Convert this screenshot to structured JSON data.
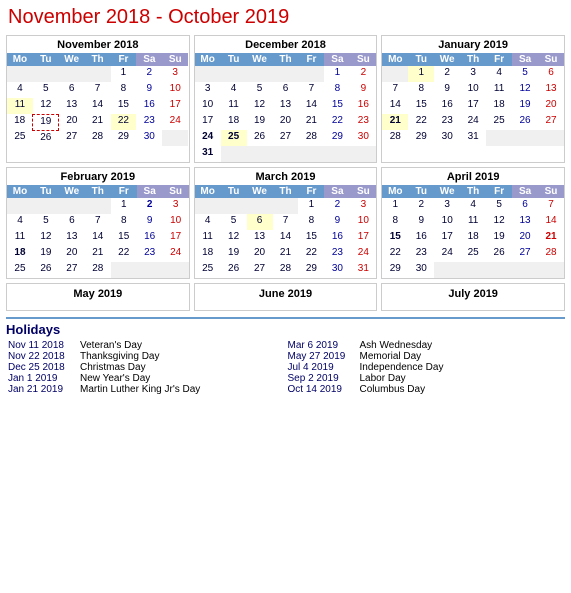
{
  "title": "November 2018 - October 2019",
  "calendars": [
    {
      "id": "nov2018",
      "title": "November 2018",
      "headers": [
        "Mo",
        "Tu",
        "We",
        "Th",
        "Fr",
        "Sa",
        "Su"
      ],
      "weeks": [
        [
          null,
          null,
          null,
          null,
          "1",
          "2",
          "3"
        ],
        [
          "4",
          "5",
          "6",
          "7",
          "8",
          "9",
          "10"
        ],
        [
          "11",
          "12",
          "13",
          "14",
          "15",
          "16",
          "17"
        ],
        [
          "18",
          "19",
          "20",
          "21",
          "22",
          "23",
          "24"
        ],
        [
          "25",
          "26",
          "27",
          "28",
          "29",
          "30",
          null
        ]
      ],
      "holidays": [
        11,
        22
      ],
      "today": 19,
      "bold": []
    },
    {
      "id": "dec2018",
      "title": "December 2018",
      "headers": [
        "Mo",
        "Tu",
        "We",
        "Th",
        "Fr",
        "Sa",
        "Su"
      ],
      "weeks": [
        [
          null,
          null,
          null,
          null,
          null,
          "1",
          "2"
        ],
        [
          "3",
          "4",
          "5",
          "6",
          "7",
          "8",
          "9"
        ],
        [
          "10",
          "11",
          "12",
          "13",
          "14",
          "15",
          "16"
        ],
        [
          "17",
          "18",
          "19",
          "20",
          "21",
          "22",
          "23"
        ],
        [
          "24",
          "25",
          "26",
          "27",
          "28",
          "29",
          "30"
        ],
        [
          "31",
          null,
          null,
          null,
          null,
          null,
          null
        ]
      ],
      "holidays": [
        25
      ],
      "today": null,
      "bold": [
        24,
        25,
        31
      ]
    },
    {
      "id": "jan2019",
      "title": "January 2019",
      "headers": [
        "Mo",
        "Tu",
        "We",
        "Th",
        "Fr",
        "Sa",
        "Su"
      ],
      "weeks": [
        [
          null,
          "1",
          "2",
          "3",
          "4",
          "5",
          "6"
        ],
        [
          "7",
          "8",
          "9",
          "10",
          "11",
          "12",
          "13"
        ],
        [
          "14",
          "15",
          "16",
          "17",
          "18",
          "19",
          "20"
        ],
        [
          "21",
          "22",
          "23",
          "24",
          "25",
          "26",
          "27"
        ],
        [
          "28",
          "29",
          "30",
          "31",
          null,
          null,
          null
        ]
      ],
      "holidays": [
        1,
        21
      ],
      "today": null,
      "bold": [
        21
      ]
    },
    {
      "id": "feb2019",
      "title": "February 2019",
      "headers": [
        "Mo",
        "Tu",
        "We",
        "Th",
        "Fr",
        "Sa",
        "Su"
      ],
      "weeks": [
        [
          null,
          null,
          null,
          null,
          "1",
          "2",
          "3"
        ],
        [
          "4",
          "5",
          "6",
          "7",
          "8",
          "9",
          "10"
        ],
        [
          "11",
          "12",
          "13",
          "14",
          "15",
          "16",
          "17"
        ],
        [
          "18",
          "19",
          "20",
          "21",
          "22",
          "23",
          "24"
        ],
        [
          "25",
          "26",
          "27",
          "28",
          null,
          null,
          null
        ]
      ],
      "holidays": [],
      "today": null,
      "bold": [
        2,
        18
      ]
    },
    {
      "id": "mar2019",
      "title": "March 2019",
      "headers": [
        "Mo",
        "Tu",
        "We",
        "Th",
        "Fr",
        "Sa",
        "Su"
      ],
      "weeks": [
        [
          null,
          null,
          null,
          null,
          "1",
          "2",
          "3"
        ],
        [
          "4",
          "5",
          "6",
          "7",
          "8",
          "9",
          "10"
        ],
        [
          "11",
          "12",
          "13",
          "14",
          "15",
          "16",
          "17"
        ],
        [
          "18",
          "19",
          "20",
          "21",
          "22",
          "23",
          "24"
        ],
        [
          "25",
          "26",
          "27",
          "28",
          "29",
          "30",
          "31"
        ]
      ],
      "holidays": [
        6
      ],
      "today": null,
      "bold": []
    },
    {
      "id": "apr2019",
      "title": "April 2019",
      "headers": [
        "Mo",
        "Tu",
        "We",
        "Th",
        "Fr",
        "Sa",
        "Su"
      ],
      "weeks": [
        [
          "1",
          "2",
          "3",
          "4",
          "5",
          "6",
          "7"
        ],
        [
          "8",
          "9",
          "10",
          "11",
          "12",
          "13",
          "14"
        ],
        [
          "15",
          "16",
          "17",
          "18",
          "19",
          "20",
          "21"
        ],
        [
          "22",
          "23",
          "24",
          "25",
          "26",
          "27",
          "28"
        ],
        [
          "29",
          "30",
          null,
          null,
          null,
          null,
          null
        ]
      ],
      "holidays": [],
      "today": null,
      "bold": [
        15,
        21
      ]
    }
  ],
  "partial_months": [
    {
      "id": "may2019",
      "title": "May 2019"
    },
    {
      "id": "jun2019",
      "title": "June 2019"
    },
    {
      "id": "jul2019",
      "title": "July 2019"
    }
  ],
  "holidays": {
    "title": "Holidays",
    "left": [
      {
        "date": "Nov 11 2018",
        "name": "Veteran's Day"
      },
      {
        "date": "Nov 22 2018",
        "name": "Thanksgiving Day"
      },
      {
        "date": "Dec 25 2018",
        "name": "Christmas Day"
      },
      {
        "date": "Jan 1 2019",
        "name": "New Year's Day"
      },
      {
        "date": "Jan 21 2019",
        "name": "Martin Luther King Jr's Day"
      }
    ],
    "right": [
      {
        "date": "Mar 6 2019",
        "name": "Ash Wednesday"
      },
      {
        "date": "May 27 2019",
        "name": "Memorial Day"
      },
      {
        "date": "Jul 4 2019",
        "name": "Independence Day"
      },
      {
        "date": "Sep 2 2019",
        "name": "Labor Day"
      },
      {
        "date": "Oct 14 2019",
        "name": "Columbus Day"
      }
    ]
  }
}
